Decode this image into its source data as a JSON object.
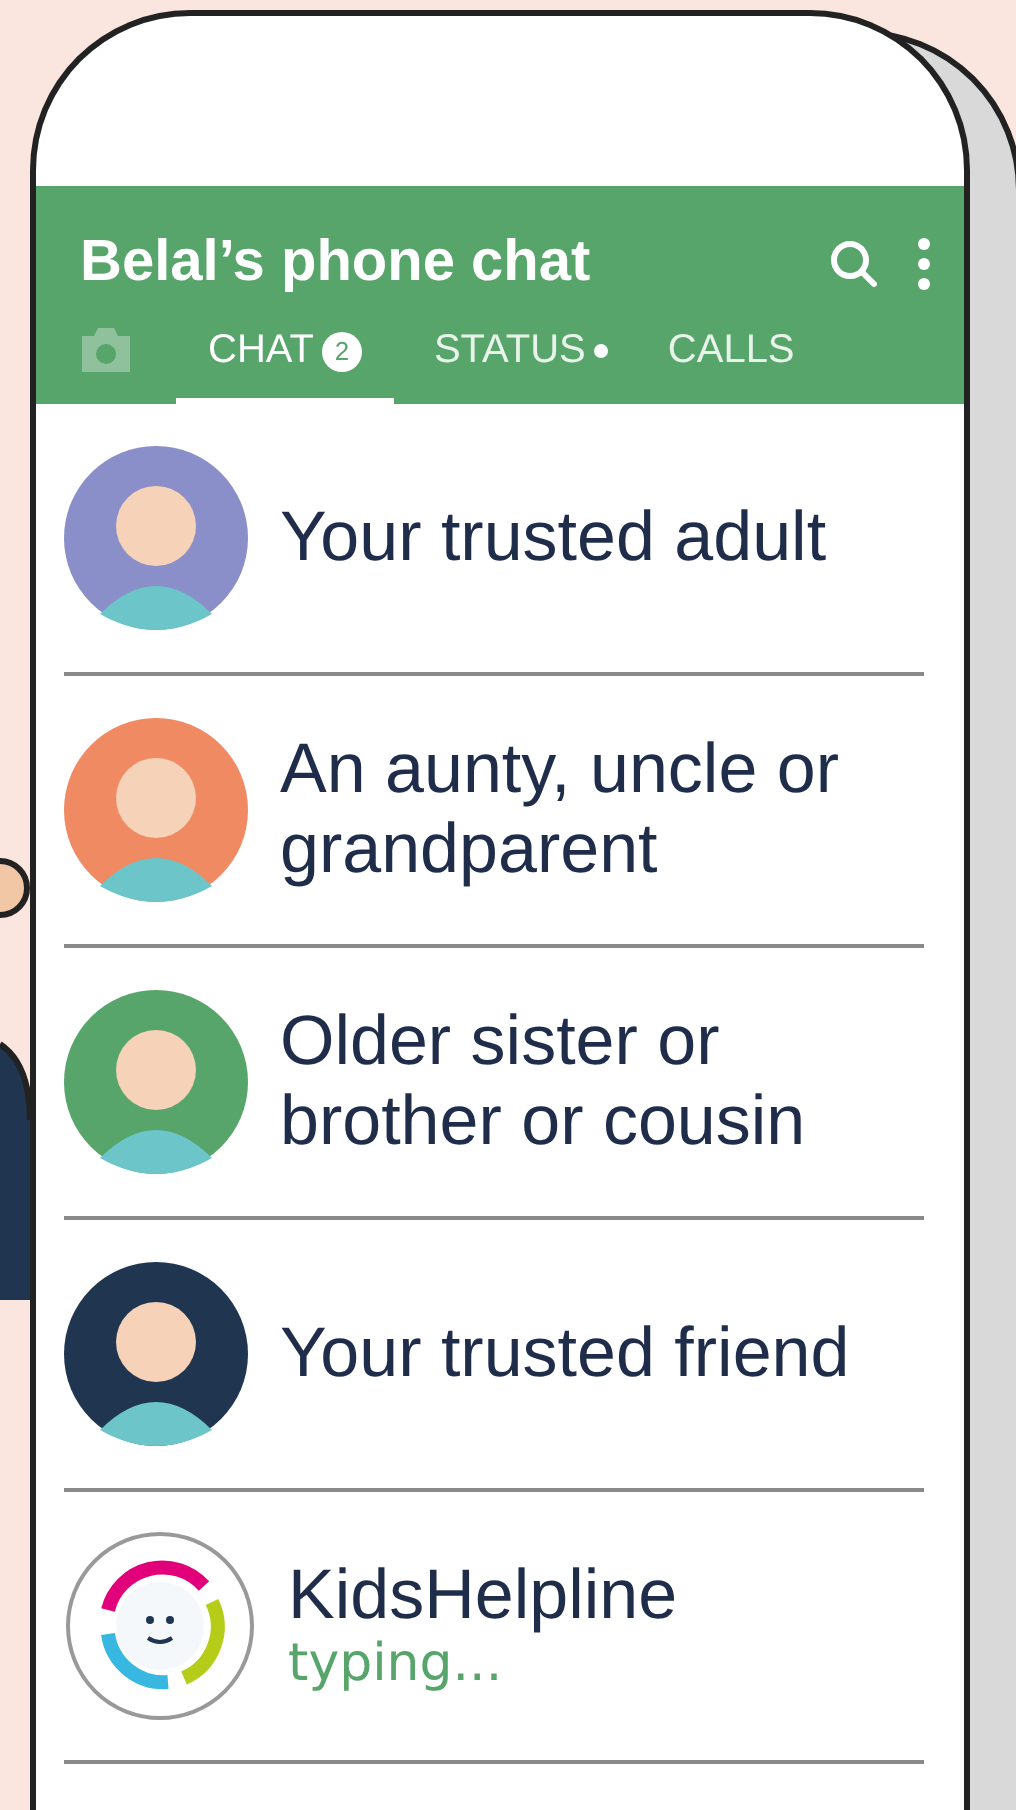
{
  "header": {
    "title": "Belal’s phone chat"
  },
  "tabs": [
    {
      "kind": "camera",
      "selected": false
    },
    {
      "kind": "text",
      "label": "CHAT",
      "badge": "2",
      "selected": true
    },
    {
      "kind": "text",
      "label": "STATUS",
      "dot": true,
      "selected": false
    },
    {
      "kind": "text",
      "label": "CALLS",
      "selected": false
    }
  ],
  "chats": [
    {
      "kind": "person",
      "name": "Your trusted adult",
      "color": "#8a8fc9"
    },
    {
      "kind": "person",
      "name": "An aunty, uncle or grandparent",
      "color": "#ef8a63"
    },
    {
      "kind": "person",
      "name": "Older sister or brother or cousin",
      "color": "#57a56b"
    },
    {
      "kind": "person",
      "name": "Your trusted friend",
      "color": "#1f3550"
    },
    {
      "kind": "logo",
      "name": "KidsHelpline",
      "status": "typing..."
    }
  ]
}
